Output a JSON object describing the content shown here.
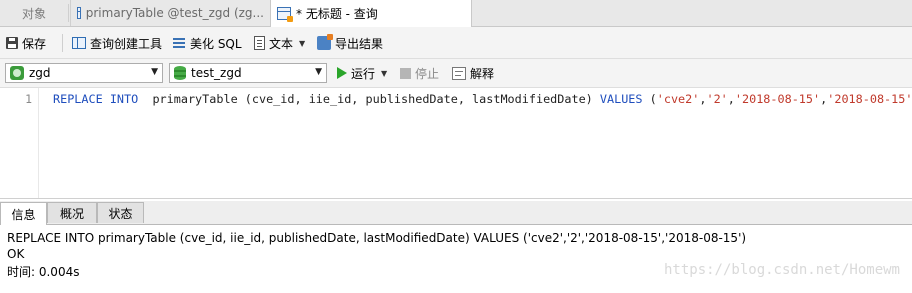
{
  "tabs": {
    "objects": "对象",
    "tab1": "primaryTable @test_zgd (zg...",
    "tab2": "* 无标题 - 查询"
  },
  "toolbar": {
    "save": "保存",
    "query_builder": "查询创建工具",
    "beautify": "美化 SQL",
    "text": "文本",
    "export": "导出结果"
  },
  "connection": {
    "connection_value": "zgd",
    "database_value": "test_zgd",
    "run": "运行",
    "stop": "停止",
    "explain": "解释"
  },
  "editor": {
    "line_number": "1",
    "tokens": {
      "k1": "REPLACE INTO",
      "p1": "  primaryTable (cve_id, iie_id, publishedDate, lastModifiedDate) ",
      "k2": "VALUES",
      "p2": " (",
      "s1": "'cve2'",
      "c1": ",",
      "s2": "'2'",
      "c2": ",",
      "s3": "'2018-08-15'",
      "c3": ",",
      "s4": "'2018-08-15'",
      "p3": ")"
    }
  },
  "result_tabs": [
    "信息",
    "概况",
    "状态"
  ],
  "messages": {
    "line1": "REPLACE INTO  primaryTable (cve_id, iie_id, publishedDate, lastModifiedDate) VALUES ('cve2','2','2018-08-15','2018-08-15')",
    "line2": "OK",
    "line3": "时间: 0.004s"
  },
  "watermark": "https://blog.csdn.net/Homewm"
}
